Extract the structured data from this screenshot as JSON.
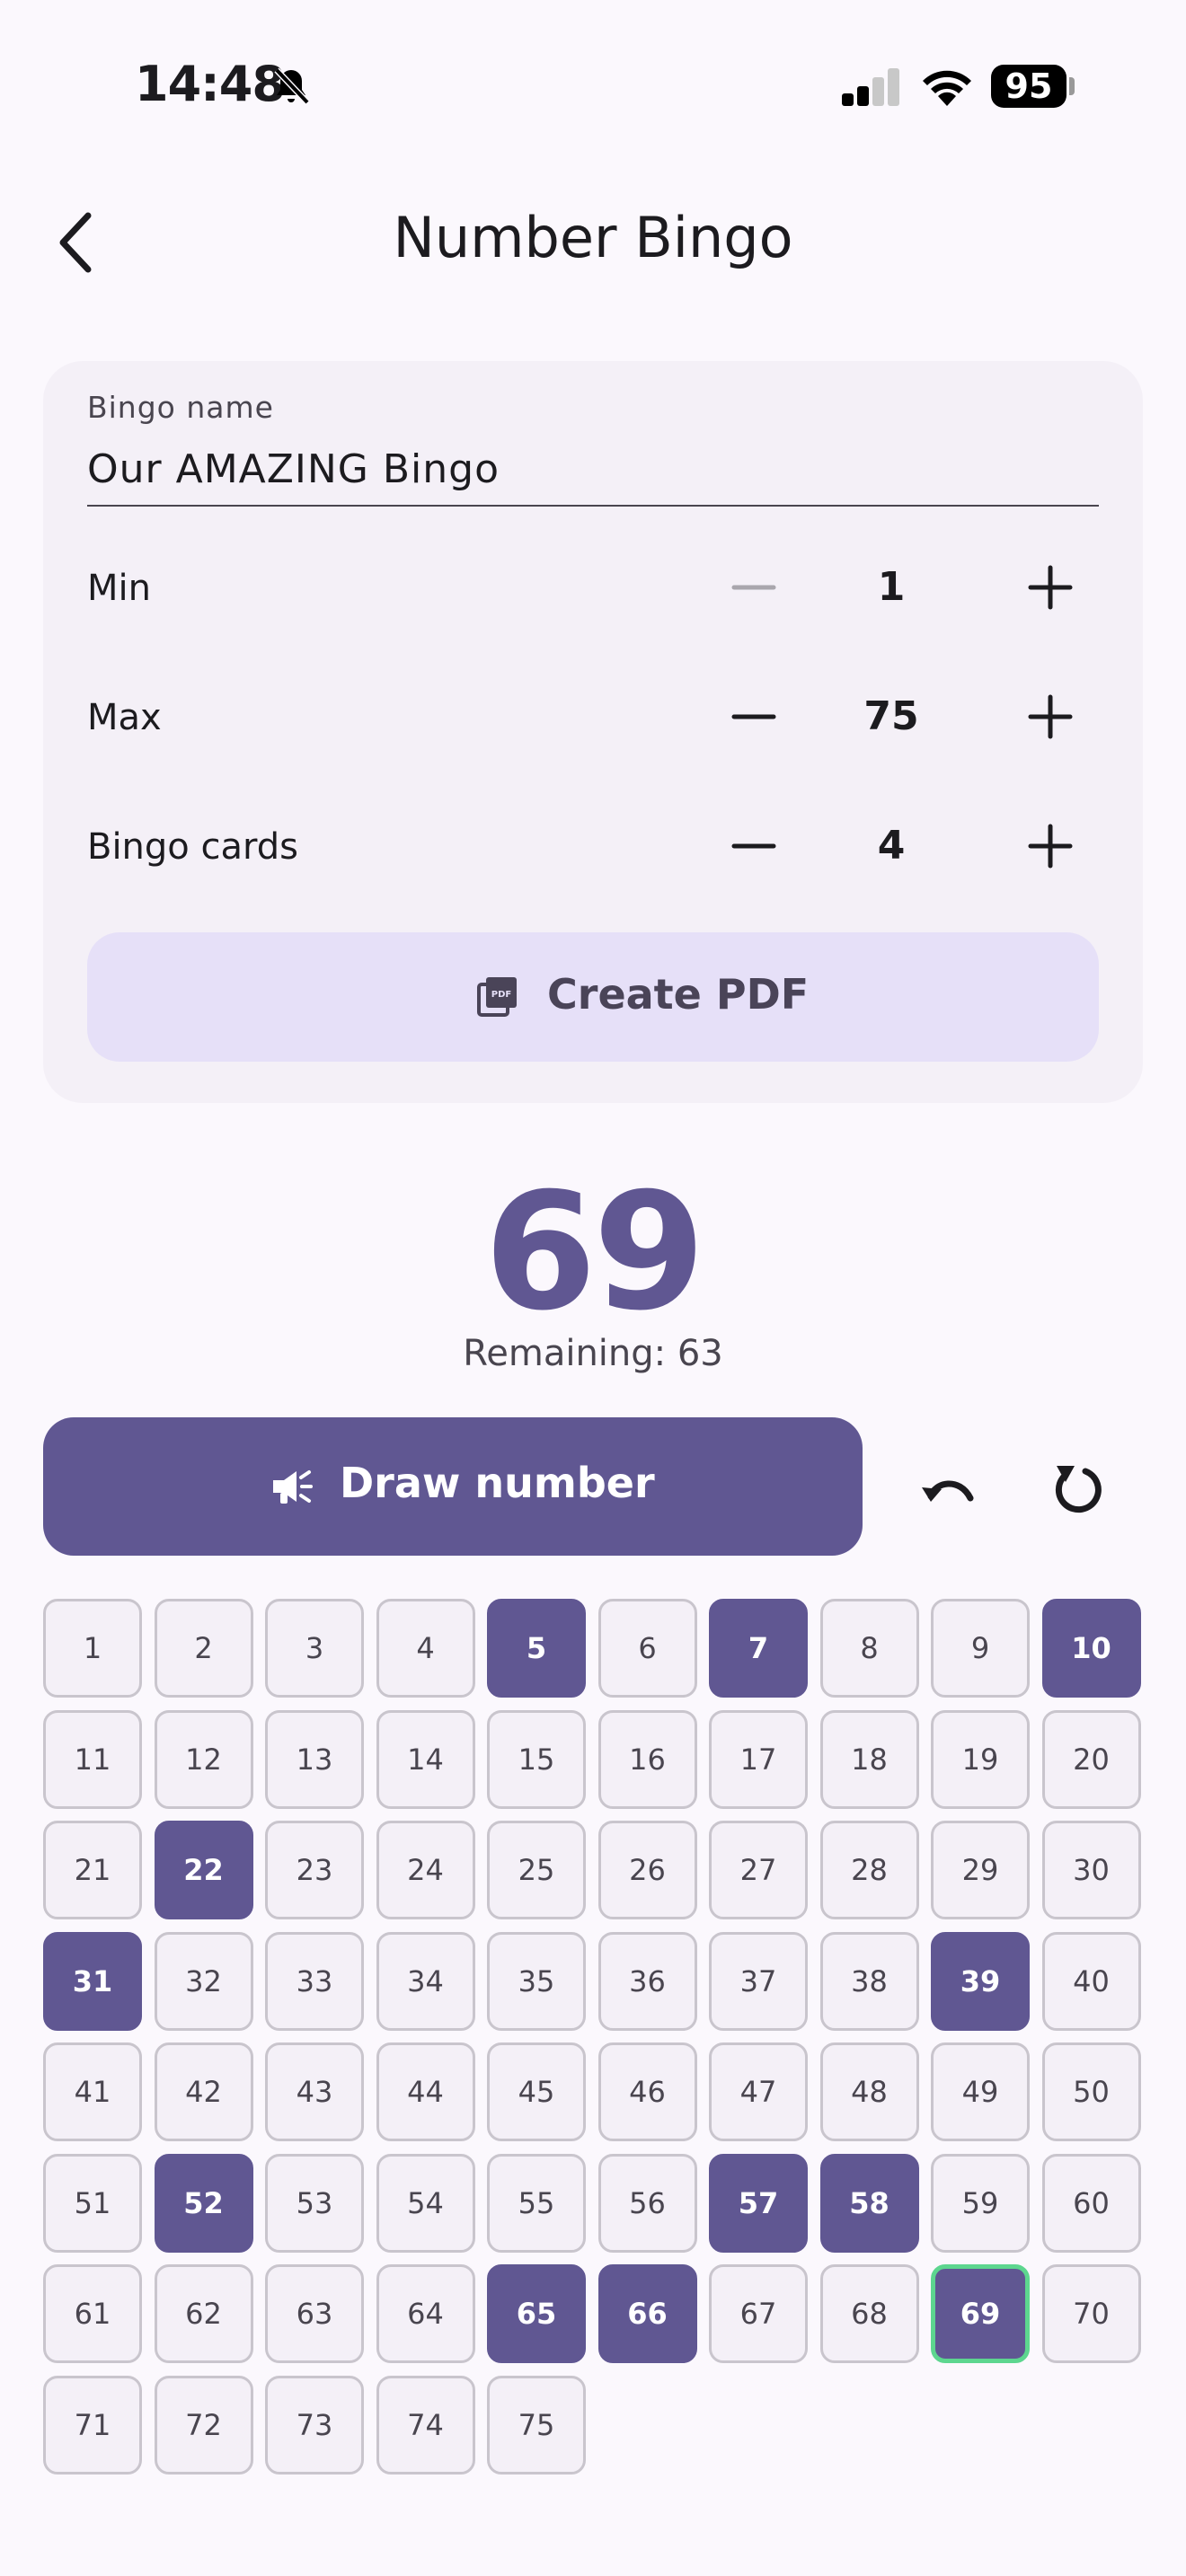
{
  "status": {
    "time": "14:48",
    "battery": "95"
  },
  "app_bar": {
    "title": "Number Bingo"
  },
  "settings": {
    "name_label": "Bingo name",
    "name_value": "Our AMAZING Bingo",
    "min": {
      "label": "Min",
      "value": "1"
    },
    "max": {
      "label": "Max",
      "value": "75"
    },
    "cards": {
      "label": "Bingo cards",
      "value": "4"
    },
    "pdf_label": "Create PDF"
  },
  "current": {
    "number": "69",
    "remaining": "Remaining: 63"
  },
  "actions": {
    "draw_label": "Draw number"
  },
  "grid": {
    "numbers": [
      "1",
      "2",
      "3",
      "4",
      "5",
      "6",
      "7",
      "8",
      "9",
      "10",
      "11",
      "12",
      "13",
      "14",
      "15",
      "16",
      "17",
      "18",
      "19",
      "20",
      "21",
      "22",
      "23",
      "24",
      "25",
      "26",
      "27",
      "28",
      "29",
      "30",
      "31",
      "32",
      "33",
      "34",
      "35",
      "36",
      "37",
      "38",
      "39",
      "40",
      "41",
      "42",
      "43",
      "44",
      "45",
      "46",
      "47",
      "48",
      "49",
      "50",
      "51",
      "52",
      "53",
      "54",
      "55",
      "56",
      "57",
      "58",
      "59",
      "60",
      "61",
      "62",
      "63",
      "64",
      "65",
      "66",
      "67",
      "68",
      "69",
      "70",
      "71",
      "72",
      "73",
      "74",
      "75"
    ],
    "drawn": [
      5,
      7,
      10,
      22,
      31,
      39,
      52,
      57,
      58,
      65,
      66,
      69
    ],
    "current": 69
  },
  "colors": {
    "accent": "#605792",
    "accent_container": "#e6e0f8",
    "current_outline": "#5dd68f",
    "surface": "#f4f0f7"
  }
}
